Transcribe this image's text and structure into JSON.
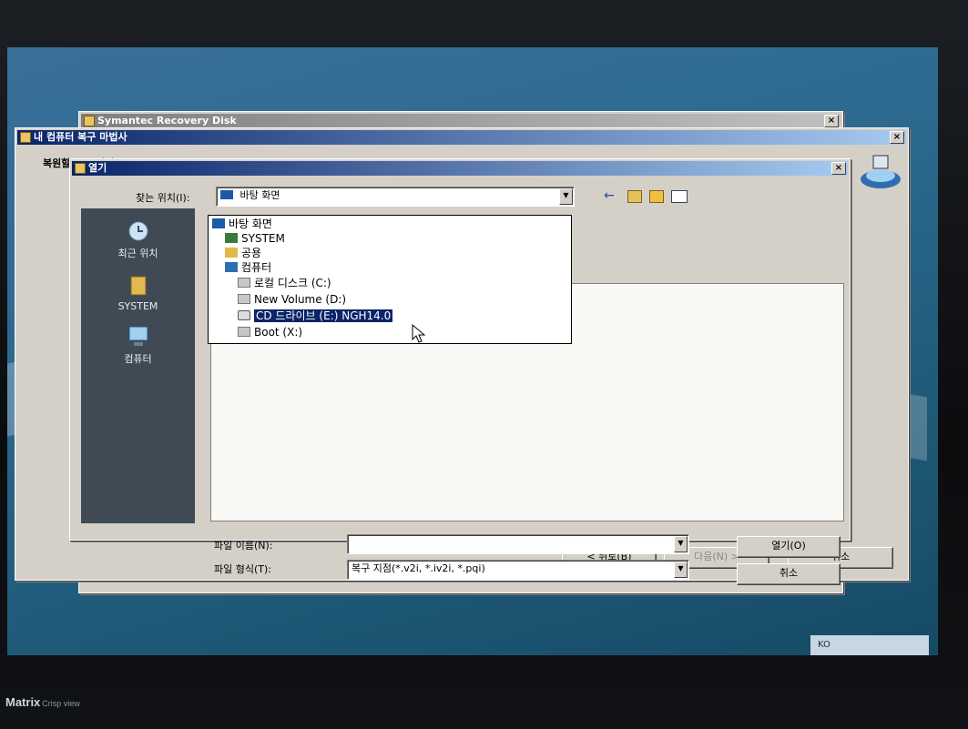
{
  "windows": {
    "back": {
      "title": "Symantec Recovery Disk"
    },
    "wizard": {
      "title": "내 컴퓨터 복구 마법사",
      "heading": "복원할 복구 지점",
      "back_label": "< 뒤로(B)",
      "next_label": "다음(N) >",
      "cancel_label": "취소"
    },
    "open_dialog": {
      "title": "열기",
      "look_in_label": "찾는 위치(I):",
      "look_in_value": "바탕 화면",
      "filename_label": "파일 이름(N):",
      "filename_value": "",
      "filetype_label": "파일 형식(T):",
      "filetype_value": "복구 지점(*.v2i, *.iv2i, *.pqi)",
      "open_label": "열기(O)",
      "cancel_label": "취소"
    }
  },
  "places": [
    {
      "label": "최근 위치",
      "icon": "recent-places-icon"
    },
    {
      "label": "SYSTEM",
      "icon": "user-folder-icon"
    },
    {
      "label": "컴퓨터",
      "icon": "computer-icon"
    }
  ],
  "look_in_items": [
    {
      "label": "바탕 화면",
      "icon": "desktop-icon",
      "indent": 0
    },
    {
      "label": "SYSTEM",
      "icon": "user-folder-icon",
      "indent": 1
    },
    {
      "label": "공용",
      "icon": "folder-icon",
      "indent": 1
    },
    {
      "label": "컴퓨터",
      "icon": "computer-icon",
      "indent": 1
    },
    {
      "label": "로컬 디스크 (C:)",
      "icon": "hard-drive-icon",
      "indent": 2
    },
    {
      "label": "New Volume (D:)",
      "icon": "hard-drive-icon",
      "indent": 2
    },
    {
      "label": "CD 드라이브 (E:) NGH14.0",
      "icon": "cd-drive-icon",
      "indent": 2,
      "selected": true
    },
    {
      "label": "Boot (X:)",
      "icon": "hard-drive-icon",
      "indent": 2
    }
  ],
  "taskbar": {
    "language": "KO"
  },
  "monitor": {
    "brand": "Matrix",
    "model": "Crisp view"
  },
  "colors": {
    "titlebar": "#0a246a",
    "selection": "#0a246a",
    "dialog_face": "#d4d0c8"
  }
}
